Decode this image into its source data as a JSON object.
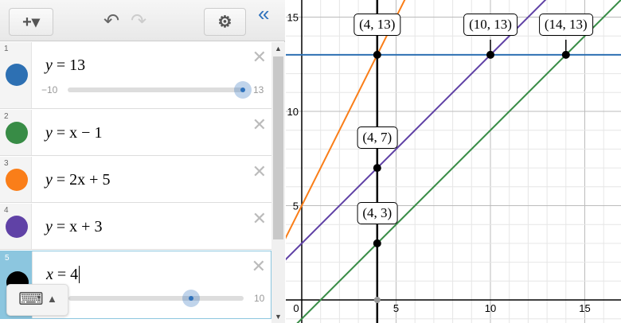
{
  "toolbar": {
    "add_label": "+▾",
    "undo": "↶",
    "redo": "↷",
    "settings": "⚙",
    "collapse": "«"
  },
  "expressions": [
    {
      "num": "1",
      "lhs": "y",
      "rhs": "= 13",
      "color": "#2d70b3",
      "slider": {
        "min": "−10",
        "max": "13",
        "value": 1.0
      }
    },
    {
      "num": "2",
      "lhs": "y",
      "rhs": "= x − 1",
      "color": "#388c46"
    },
    {
      "num": "3",
      "lhs": "y",
      "rhs": "= 2x + 5",
      "color": "#fa7e19"
    },
    {
      "num": "4",
      "lhs": "y",
      "rhs": "= x + 3",
      "color": "#6042a6"
    },
    {
      "num": "5",
      "lhs": "x",
      "rhs": "= 4",
      "color": "#000000",
      "slider": {
        "max": "10",
        "value": 0.7
      }
    }
  ],
  "graph": {
    "x_ticks": [
      "0",
      "5",
      "10",
      "15"
    ],
    "y_ticks": [
      "5",
      "10",
      "15"
    ],
    "points": [
      {
        "label": "(4, 13)",
        "x": 4,
        "y": 13
      },
      {
        "label": "(10, 13)",
        "x": 10,
        "y": 13
      },
      {
        "label": "(14, 13)",
        "x": 14,
        "y": 13
      },
      {
        "label": "(4, 7)",
        "x": 4,
        "y": 7
      },
      {
        "label": "(4, 3)",
        "x": 4,
        "y": 3
      }
    ]
  },
  "keyboard": {
    "icon": "⌨",
    "arrow": "▲"
  }
}
